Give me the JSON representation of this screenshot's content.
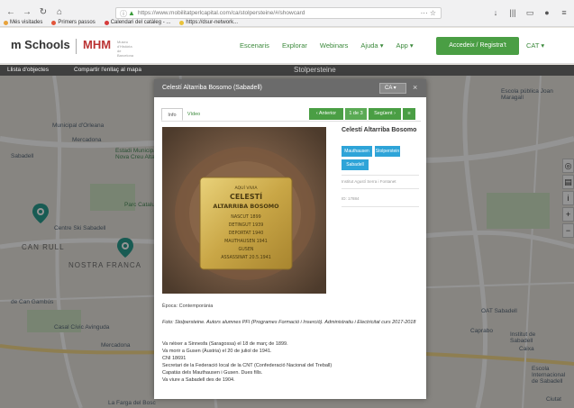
{
  "browser": {
    "url": "https://www.mobilitatperlcapital.com/ca/stolpersteine/#/showcard",
    "url_menu": "··· ☆",
    "bookmarks": [
      "Més visitades",
      "Primers passos",
      "Calendari del catàleg - ...",
      "https://dsur-network..."
    ]
  },
  "header": {
    "logo_main": "m Schools",
    "logo_second": "MHM",
    "logo_second_sub": "Museu d'Història de Barcelona",
    "menu": [
      "Escenaris",
      "Explorar",
      "Webinars",
      "Ajuda ▾",
      "App ▾"
    ],
    "register_label": "Accedeix / Registra't",
    "language_menu": "CAT ▾"
  },
  "subbar": {
    "link_left": "Llista d'objectes",
    "link_mid": "Compartir l'enllaç al mapa",
    "title": "Stolpersteine"
  },
  "map": {
    "labels": [
      {
        "text": "Municipal d'Orleana",
        "cls": ""
      },
      {
        "text": "Mercadona",
        "cls": ""
      },
      {
        "text": "Sabadell",
        "cls": ""
      },
      {
        "text": "Estadi Municipal Nova Creu Alta",
        "cls": "green"
      },
      {
        "text": "Parc Catalunya",
        "cls": "green"
      },
      {
        "text": "Centre Ski Sabadell",
        "cls": ""
      },
      {
        "text": "CAN RULL",
        "cls": "big"
      },
      {
        "text": "NOSTRA FRANCA",
        "cls": "big"
      },
      {
        "text": "de Can Gambús",
        "cls": ""
      },
      {
        "text": "Casal Cívic Avinguda",
        "cls": ""
      },
      {
        "text": "Mercadona",
        "cls": ""
      },
      {
        "text": "La Farga del Bosc",
        "cls": ""
      },
      {
        "text": "Escola pública Joan Maragall",
        "cls": ""
      },
      {
        "text": "OAT Sabadell",
        "cls": ""
      },
      {
        "text": "Caprabo",
        "cls": ""
      },
      {
        "text": "Caixa",
        "cls": ""
      },
      {
        "text": "Institut de Sabadell",
        "cls": ""
      },
      {
        "text": "Escola Internacional de Sabadell",
        "cls": ""
      },
      {
        "text": "Ciutat",
        "cls": ""
      }
    ]
  },
  "modal": {
    "title": "Celestí Altarriba Bosomo (Sabadell)",
    "language": "CA ▾",
    "close": "×",
    "tabs": [
      "Info",
      "Vídeo"
    ],
    "pager": {
      "prev": "‹ Anterior",
      "position": "1 de 3",
      "next": "Següent ›",
      "list": "≡"
    },
    "stone": {
      "lines": [
        "AQUÍ VIVIA",
        "CELESTÍ",
        "ALTARRIBA BOSOMO",
        "NASCUT 1899",
        "DETINGUT 1939",
        "DEPORTAT 1940",
        "MAUTHAUSEN 1941",
        "GUSEN",
        "ASSASSINAT 20.5.1941"
      ]
    },
    "person_name": "Celestí Altarriba Bosomo",
    "tags": [
      "Mauthausen",
      "Stolperstein",
      "Sabadell"
    ],
    "institution": "Institut Agustí Serra i Fontanet",
    "id_label": "ID: 17884",
    "caption": "Època: Contemporània",
    "credit": "Foto: Stolpersteine. Autors alumnes PFI (Programes Formació i Inserció). Administratiu i Electricitat curs 2017-2018",
    "bio": [
      "Va néixer a Sinnesfa (Saragossa) el 18 de març de 1899.",
      "Va morir a Gusen (Àustria) el 20 de juliol de 1941.",
      "CNI 18691",
      "Secretari de la Federació local de la CNT (Confederació Nacional del Treball)",
      "Capatàs dels Mauthausen i Gusen. Dues fills.",
      "Va viure a Sabadell des de 1904."
    ]
  },
  "colors": {
    "accent_green": "#4a9e44",
    "tag_blue": "#2ea4d8",
    "modal_header": "#6b6b6b",
    "map_pin": "#2a9d8f"
  }
}
